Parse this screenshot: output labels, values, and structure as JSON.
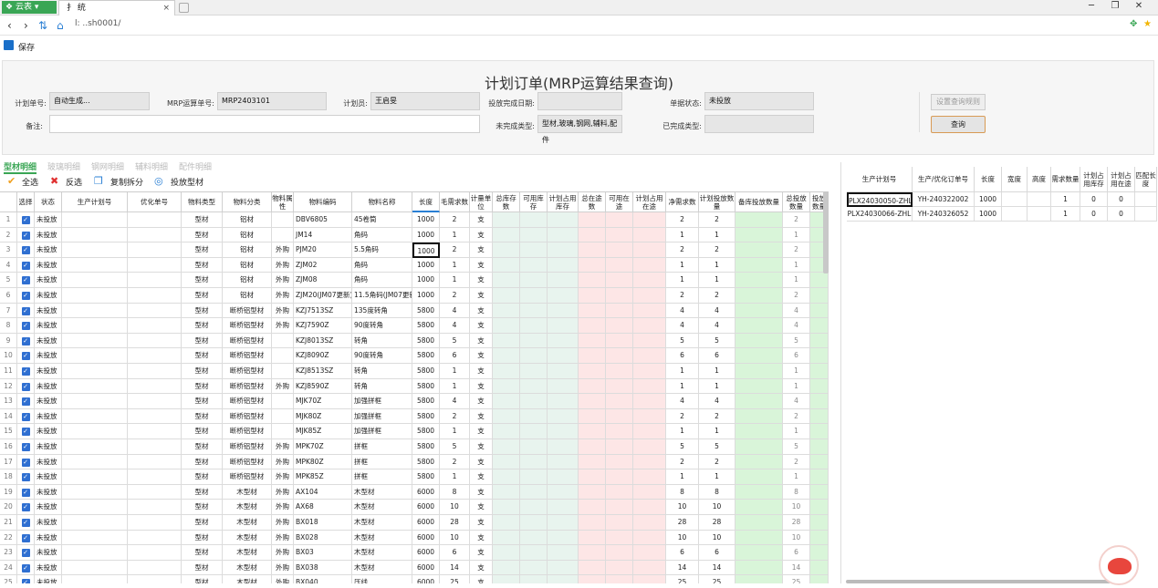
{
  "browser": {
    "brand_label": "云表",
    "tab_title": "扌    统",
    "address": "l:          ..sh0001/"
  },
  "toolbar": {
    "save_label": "保存"
  },
  "form": {
    "title": "计划订单(MRP运算结果查询)",
    "plan_no": {
      "label": "计划单号:",
      "value": "自动生成..."
    },
    "mrp_no": {
      "label": "MRP运算单号:",
      "value": "MRP2403101"
    },
    "planner": {
      "label": "计划员:",
      "value": "王启旻"
    },
    "finish_date": {
      "label": "投放完成日期:",
      "value": ""
    },
    "status": {
      "label": "单据状态:",
      "value": "未投放"
    },
    "remark": {
      "label": "备注:",
      "value": ""
    },
    "unfinished_type": {
      "label": "未完成类型:",
      "value": "型材,玻璃,钢网,辅料,配件"
    },
    "finished_type": {
      "label": "已完成类型:",
      "value": ""
    },
    "set_rules_button": "设置查询规则",
    "query_button": "查询"
  },
  "tabs": [
    "型材明细",
    "玻璃明细",
    "钢网明细",
    "辅料明细",
    "配件明细"
  ],
  "actions": {
    "select_all": "全选",
    "invert": "反选",
    "copy_split": "复制拆分",
    "release": "投放型材"
  },
  "colors": {
    "accent": "#3aa655",
    "query_border": "#d89a54",
    "col_green": "#e8f4ee",
    "col_red": "#fde6e6",
    "col_bright_green": "#d9f5d9"
  },
  "grid": {
    "headers": [
      "",
      "选择",
      "状态",
      "生产计划号",
      "优化单号",
      "物料类型",
      "物料分类",
      "物料属性",
      "物料编码",
      "物料名称",
      "长度",
      "毛需求数",
      "计量单位",
      "总库存数",
      "可用库存",
      "计划占用库存",
      "总在途数",
      "可用在途",
      "计划占用在途",
      "净需求数",
      "计划投放数量",
      "备库投放数量",
      "总投放数量",
      "投放数量"
    ],
    "rows": [
      [
        "1",
        "未投放",
        "型材",
        "铝材",
        "",
        "DBV6805",
        "45卷筒",
        "1000",
        "2",
        "支",
        "2",
        "2",
        "2"
      ],
      [
        "2",
        "未投放",
        "型材",
        "铝材",
        "",
        "JM14",
        "角码",
        "1000",
        "1",
        "支",
        "1",
        "1",
        "1"
      ],
      [
        "3",
        "未投放",
        "型材",
        "铝材",
        "外购",
        "PJM20",
        "5.5角码",
        "1000",
        "2",
        "支",
        "2",
        "2",
        "2"
      ],
      [
        "4",
        "未投放",
        "型材",
        "铝材",
        "外购",
        "ZJM02",
        "角码",
        "1000",
        "1",
        "支",
        "1",
        "1",
        "1"
      ],
      [
        "5",
        "未投放",
        "型材",
        "铝材",
        "外购",
        "ZJM08",
        "角码",
        "1000",
        "1",
        "支",
        "1",
        "1",
        "1"
      ],
      [
        "6",
        "未投放",
        "型材",
        "铝材",
        "外购",
        "ZJM20(JM07更新)",
        "11.5角码(JM07更新)",
        "1000",
        "2",
        "支",
        "2",
        "2",
        "2"
      ],
      [
        "7",
        "未投放",
        "型材",
        "断桥铝型材",
        "外购",
        "KZJ7513SZ",
        "135度转角",
        "5800",
        "4",
        "支",
        "4",
        "4",
        "4"
      ],
      [
        "8",
        "未投放",
        "型材",
        "断桥铝型材",
        "外购",
        "KZJ7590Z",
        "90度转角",
        "5800",
        "4",
        "支",
        "4",
        "4",
        "4"
      ],
      [
        "9",
        "未投放",
        "型材",
        "断桥铝型材",
        "",
        "KZJ8013SZ",
        "转角",
        "5800",
        "5",
        "支",
        "5",
        "5",
        "5"
      ],
      [
        "10",
        "未投放",
        "型材",
        "断桥铝型材",
        "",
        "KZJ8090Z",
        "90度转角",
        "5800",
        "6",
        "支",
        "6",
        "6",
        "6"
      ],
      [
        "11",
        "未投放",
        "型材",
        "断桥铝型材",
        "",
        "KZJ8513SZ",
        "转角",
        "5800",
        "1",
        "支",
        "1",
        "1",
        "1"
      ],
      [
        "12",
        "未投放",
        "型材",
        "断桥铝型材",
        "外购",
        "KZJ8590Z",
        "转角",
        "5800",
        "1",
        "支",
        "1",
        "1",
        "1"
      ],
      [
        "13",
        "未投放",
        "型材",
        "断桥铝型材",
        "",
        "MJK70Z",
        "加强拼框",
        "5800",
        "4",
        "支",
        "4",
        "4",
        "4"
      ],
      [
        "14",
        "未投放",
        "型材",
        "断桥铝型材",
        "",
        "MJK80Z",
        "加强拼框",
        "5800",
        "2",
        "支",
        "2",
        "2",
        "2"
      ],
      [
        "15",
        "未投放",
        "型材",
        "断桥铝型材",
        "",
        "MJK85Z",
        "加强拼框",
        "5800",
        "1",
        "支",
        "1",
        "1",
        "1"
      ],
      [
        "16",
        "未投放",
        "型材",
        "断桥铝型材",
        "外购",
        "MPK70Z",
        "拼框",
        "5800",
        "5",
        "支",
        "5",
        "5",
        "5"
      ],
      [
        "17",
        "未投放",
        "型材",
        "断桥铝型材",
        "外购",
        "MPK80Z",
        "拼框",
        "5800",
        "2",
        "支",
        "2",
        "2",
        "2"
      ],
      [
        "18",
        "未投放",
        "型材",
        "断桥铝型材",
        "外购",
        "MPK85Z",
        "拼框",
        "5800",
        "1",
        "支",
        "1",
        "1",
        "1"
      ],
      [
        "19",
        "未投放",
        "型材",
        "木型材",
        "外购",
        "AX104",
        "木型材",
        "6000",
        "8",
        "支",
        "8",
        "8",
        "8"
      ],
      [
        "20",
        "未投放",
        "型材",
        "木型材",
        "外购",
        "AX68",
        "木型材",
        "6000",
        "10",
        "支",
        "10",
        "10",
        "10"
      ],
      [
        "21",
        "未投放",
        "型材",
        "木型材",
        "外购",
        "BX018",
        "木型材",
        "6000",
        "28",
        "支",
        "28",
        "28",
        "28"
      ],
      [
        "22",
        "未投放",
        "型材",
        "木型材",
        "外购",
        "BX028",
        "木型材",
        "6000",
        "10",
        "支",
        "10",
        "10",
        "10"
      ],
      [
        "23",
        "未投放",
        "型材",
        "木型材",
        "外购",
        "BX03",
        "木型材",
        "6000",
        "6",
        "支",
        "6",
        "6",
        "6"
      ],
      [
        "24",
        "未投放",
        "型材",
        "木型材",
        "外购",
        "BX038",
        "木型材",
        "6000",
        "14",
        "支",
        "14",
        "14",
        "14"
      ],
      [
        "25",
        "未投放",
        "型材",
        "木型材",
        "外购",
        "BX040",
        "压线",
        "6000",
        "25",
        "支",
        "25",
        "25",
        "25"
      ]
    ]
  },
  "right_grid": {
    "headers": [
      "生产计划号",
      "生产/优化订单号",
      "长度",
      "宽度",
      "高度",
      "需求数量",
      "计划占用库存",
      "计划占用在途",
      "匹配长度"
    ],
    "rows": [
      [
        "PLX24030050-ZHL",
        "YH-240322002",
        "1000",
        "",
        "",
        "1",
        "0",
        "0",
        ""
      ],
      [
        "PLX24030066-ZHL",
        "YH-240326052",
        "1000",
        "",
        "",
        "1",
        "0",
        "0",
        ""
      ]
    ]
  }
}
